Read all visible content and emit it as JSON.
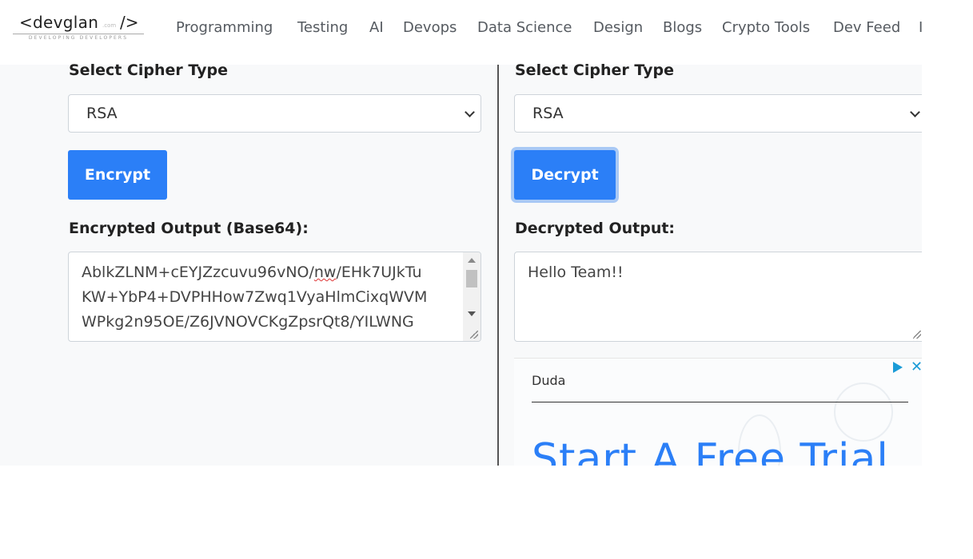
{
  "header": {
    "logo": {
      "main": "<devglan",
      "tld": ".com",
      "close": "/>",
      "tagline": "DEVELOPING DEVELOPERS"
    },
    "nav": [
      "Programming",
      "Testing",
      "AI",
      "Devops",
      "Data Science",
      "Design",
      "Blogs",
      "Crypto Tools",
      "Dev Feed",
      "I"
    ]
  },
  "encrypt_panel": {
    "cipher_label": "Select Cipher Type",
    "cipher_value": "RSA",
    "button_label": "Encrypt",
    "output_label": "Encrypted Output (Base64):",
    "output_line1_a": "AblkZLNM+cEYJZzcuvu96vNO/",
    "output_line1_b": "nw",
    "output_line1_c": "/EHk7UJkTu",
    "output_line2": "KW+YbP4+DVPHHow7Zwq1VyaHlmCixqWVM",
    "output_line3": "WPkg2n95OE/Z6JVNOVCKgZpsrQt8/YILWNG"
  },
  "decrypt_panel": {
    "cipher_label": "Select Cipher Type",
    "cipher_value": "RSA",
    "button_label": "Decrypt",
    "output_label": "Decrypted Output:",
    "output_value": "Hello Team!!"
  },
  "ad": {
    "brand": "Duda",
    "headline": "Start A Free Trial",
    "accent_color": "#2b7ff7"
  },
  "colors": {
    "primary_button": "#2b7ff7",
    "page_background": "#f8f9fa"
  }
}
